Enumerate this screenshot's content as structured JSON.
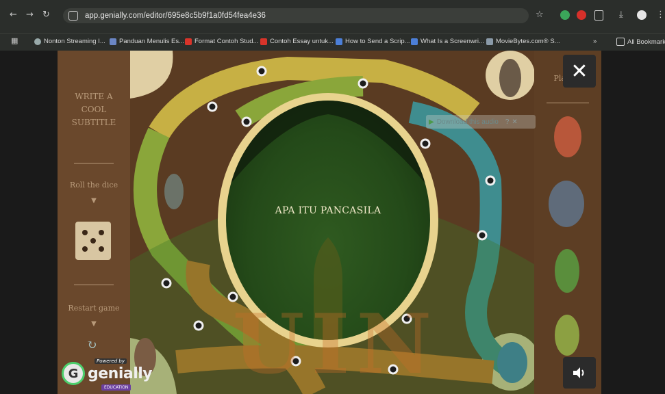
{
  "browser": {
    "url": "app.genially.com/editor/695e8c5b9f1a0fd54fea4e36",
    "bookmarks": [
      "Nonton Streaming I...",
      "Panduan Menulis Es...",
      "Format Contoh Stud...",
      "Contoh Essay untuk...",
      "How to Send a Scrip...",
      "What Is a Screenwri...",
      "MovieBytes.com® S...",
      "All Bookmarks"
    ],
    "more_label": "»"
  },
  "game": {
    "left_panel": {
      "subtitle": [
        "WRITE A",
        "COOL",
        "SUBTITLE"
      ],
      "roll_label": "Roll the dice",
      "restart_label": "Restart game"
    },
    "right_panel": {
      "players_label": "Players"
    },
    "question": "APA ITU PANCASILA",
    "audio_overlay_label": "Download this audio",
    "watermark": "UIN",
    "logo": {
      "powered": "Powered by",
      "name": "genially",
      "edu": "EDUCATION"
    },
    "close_label": "✕"
  },
  "colors": {
    "board_brown": "#5a3b22",
    "path_green": "#8aa63a",
    "path_yellow": "#c8b045",
    "path_teal": "#3f8d8f",
    "frame_gold": "#e8d38e",
    "circle_green": "#2f5a20"
  }
}
